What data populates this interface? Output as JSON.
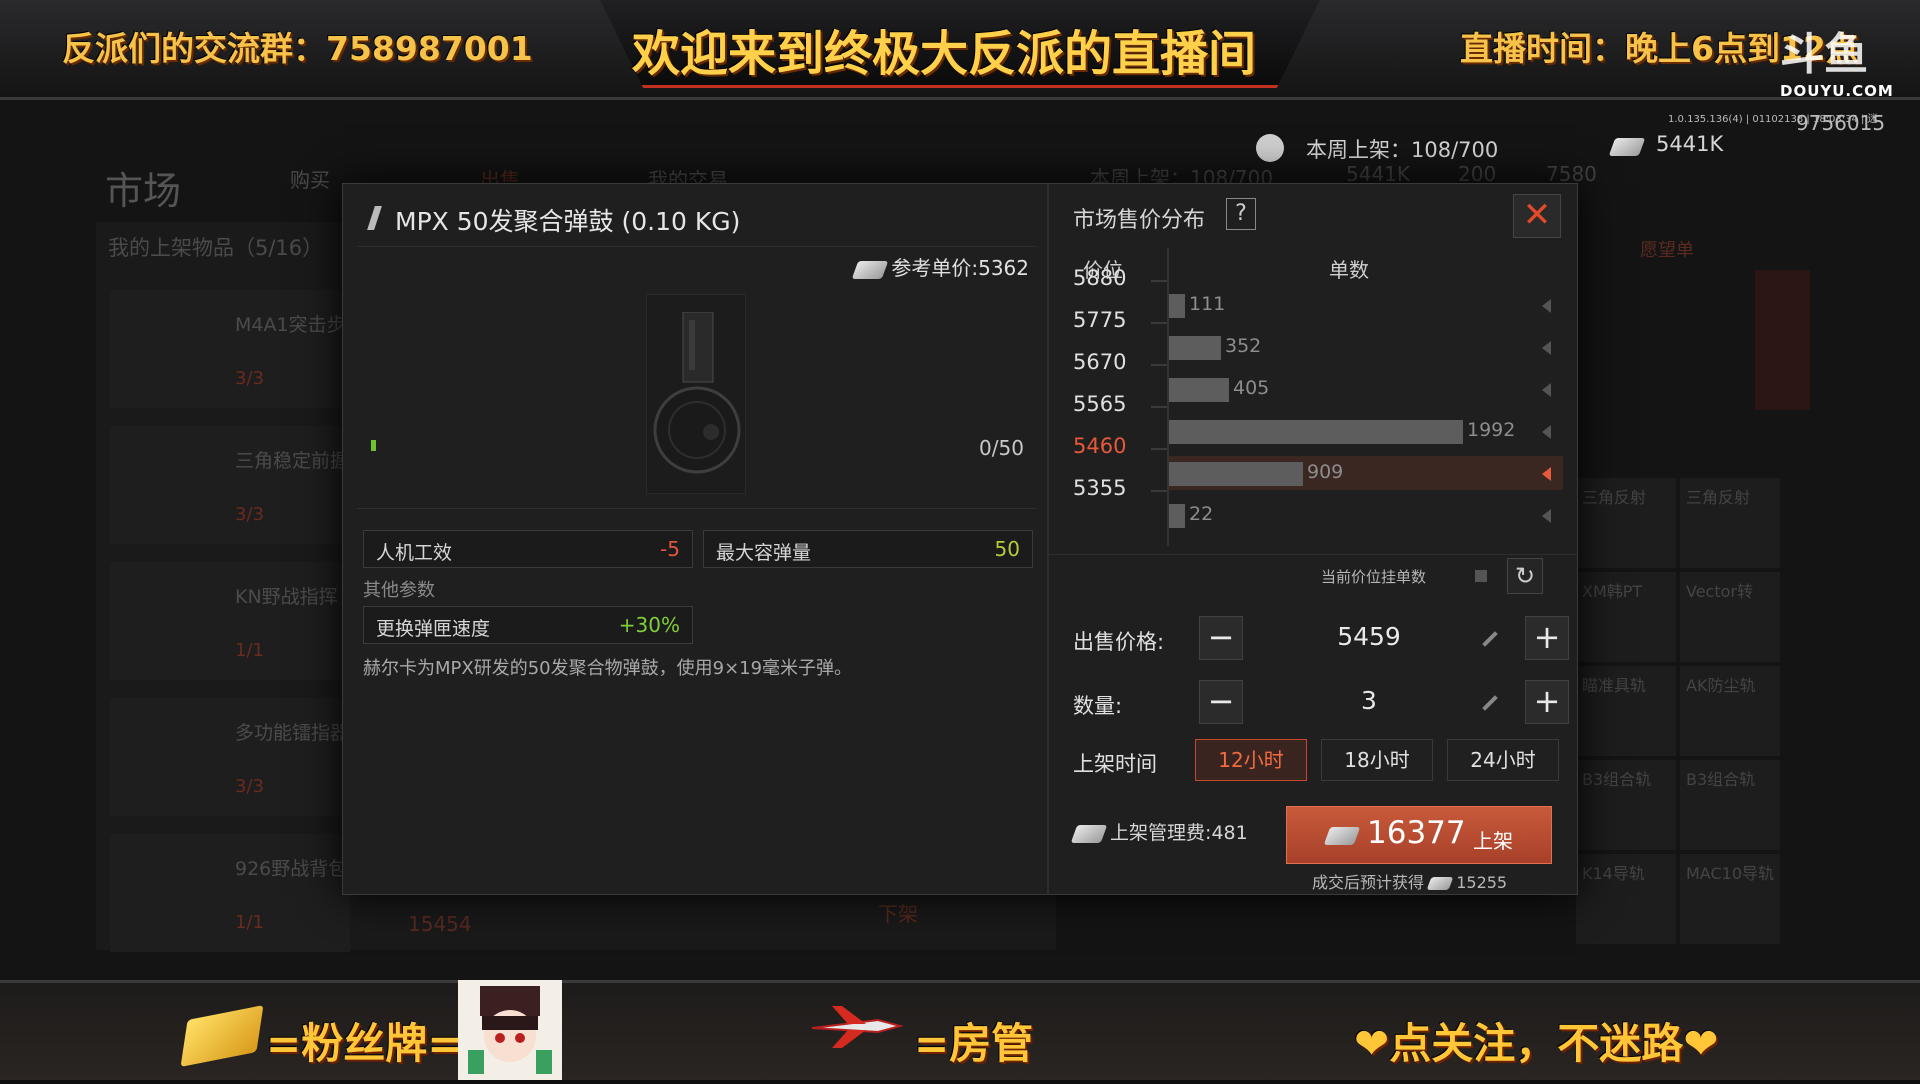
{
  "overlay": {
    "top_left": "反派们的交流群：758987001",
    "top_center": "欢迎来到终极大反派的直播间",
    "top_right": "直播时间：晚上6点到12点",
    "logo_main": "斗鱼",
    "logo_sub": "DOUYU.COM",
    "version": "1.0.135.136(4) | 01102138 | 18:03:34 | 迷",
    "viewer_count": "9756015",
    "bottom_fans": "=粉丝牌=",
    "bottom_mod": "=房管",
    "bottom_follow": "❤点关注，不迷路❤"
  },
  "game": {
    "market_title": "市场",
    "tabs": [
      "购买",
      "出售",
      "我的交易"
    ],
    "listing_count": "我的上架物品（5/16）",
    "wish_list": "愿望单",
    "bg_items": [
      {
        "name": "M4A1突击步",
        "count": "3/3"
      },
      {
        "name": "三角稳定前握",
        "count": "3/3"
      },
      {
        "name": "KN野战指挥",
        "count": "1/1"
      },
      {
        "name": "多功能镭指器",
        "count": "3/3"
      },
      {
        "name": "926野战背包",
        "count": "1/1"
      }
    ],
    "bg_total": "15454",
    "bg_unlist": "下架",
    "bg_grid": [
      "三角反射",
      "三角反射",
      "XM韩PT",
      "Vector转",
      "瞄准具轨",
      "AK防尘轨",
      "B3组合轨",
      "B3组合轨",
      "K14导轨",
      "MAC10导轨"
    ],
    "hud_weekly_label": "本周上架：108/700",
    "hud_money": "5441K",
    "hud_bg_weekly": "本周上架：108/700",
    "hud_bg_money": "5441K",
    "hud_bg_coin": "200",
    "hud_bg_other": "7580"
  },
  "dialog": {
    "item_title": "MPX 50发聚合弹鼓 (0.10 KG)",
    "ref_price": "参考单价:5362",
    "ammo_count": "0/50",
    "stats": [
      {
        "label": "人机工效",
        "value": "-5",
        "color": "#e0553c"
      },
      {
        "label": "最大容弹量",
        "value": "50",
        "color": "#b8c93a"
      },
      {
        "label": "更换弹匣速度",
        "value": "+30%",
        "color": "#7fcf3a"
      }
    ],
    "other_params": "其他参数",
    "description": "赫尔卡为MPX研发的50发聚合物弹鼓，使用9×19毫米子弹。",
    "distribution": {
      "title": "市场售价分布",
      "help": "?",
      "col_price": "价位",
      "col_qty": "单数",
      "rows": [
        {
          "price": "5880",
          "qty": 111,
          "qty_label": "111",
          "selected": false
        },
        {
          "price": "5775",
          "qty": 352,
          "qty_label": "352",
          "selected": false
        },
        {
          "price": "5670",
          "qty": 405,
          "qty_label": "405",
          "selected": false
        },
        {
          "price": "5565",
          "qty": 1992,
          "qty_label": "1992",
          "selected": false
        },
        {
          "price": "5460",
          "qty": 909,
          "qty_label": "909",
          "selected": true
        },
        {
          "price": "5355",
          "qty": 22,
          "qty_label": "22",
          "selected": false
        }
      ],
      "current_orders": "当前价位挂单数"
    },
    "sell_price_label": "出售价格:",
    "sell_price": "5459",
    "quantity_label": "数量:",
    "quantity": "3",
    "list_time_label": "上架时间",
    "time_options": [
      "12小时",
      "18小时",
      "24小时"
    ],
    "selected_time": "12小时",
    "fee": "上架管理费:481",
    "list_total": "16377",
    "list_button": "上架",
    "expected": "成交后预计获得",
    "expected_value": "15255",
    "colors": {
      "accent": "#e8593a",
      "button": "#b84a30"
    }
  }
}
